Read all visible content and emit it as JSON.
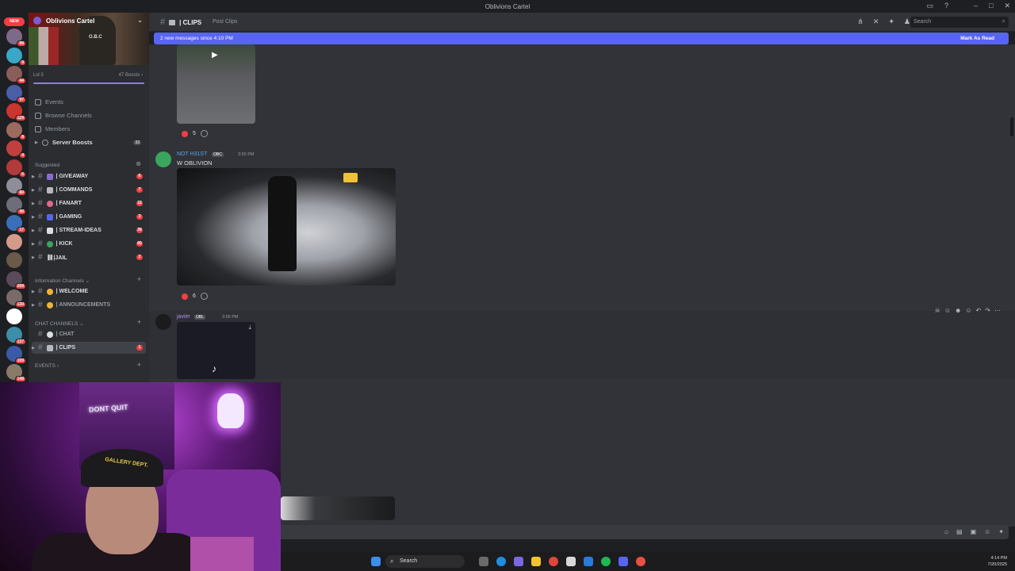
{
  "window": {
    "title": "Oblivions Cartel"
  },
  "rail": {
    "new_badge": "NEW",
    "badges": [
      "99",
      "9",
      "44",
      "97",
      "129",
      "8",
      "4",
      "6",
      "80",
      "40",
      "17",
      "",
      "",
      "209",
      "130",
      "",
      "137",
      "109",
      "148"
    ]
  },
  "server": {
    "name": "Oblivions Cartel",
    "level": "Lvl 3",
    "boosts": "47 Boosts",
    "banner_text": "O.B.C"
  },
  "sidebar": {
    "nav": [
      {
        "label": "Events",
        "icon": "calendar-icon"
      },
      {
        "label": "Browse Channels",
        "icon": "browse-icon"
      },
      {
        "label": "Members",
        "icon": "members-icon"
      }
    ],
    "server_boosts": {
      "label": "Server Boosts",
      "count": "33"
    },
    "suggested_label": "Suggested",
    "suggested": [
      {
        "name": "| GIVEAWAY",
        "count": "6",
        "color": "#8a6ad8"
      },
      {
        "name": "| COMMANDS",
        "count": "7",
        "color": "#b5bac1"
      },
      {
        "name": "| FANART",
        "count": "12",
        "color": "#e06a8a"
      },
      {
        "name": "| GAMING",
        "count": "3",
        "color": "#5865f2"
      },
      {
        "name": "| STREAM-IDEAS",
        "count": "39",
        "color": "#dbdee1"
      },
      {
        "name": "| KICK",
        "count": "60",
        "color": "#3ba55d"
      },
      {
        "name": "⛓|JAIL",
        "count": "2",
        "color": ""
      }
    ],
    "info_label": "Information Channels",
    "info": [
      {
        "name": "| WELCOME",
        "color": "#f0b232"
      },
      {
        "name": "| ANNOUNCEMENTS",
        "color": "#f0b232"
      }
    ],
    "chat_label": "CHAT CHANNELS",
    "chat": [
      {
        "name": "| CHAT",
        "count": ""
      },
      {
        "name": "| CLIPS",
        "count": "1"
      }
    ],
    "events_label": "EVENTS"
  },
  "header": {
    "channel": "| CLIPS",
    "topic": "Post Clips",
    "search_placeholder": "Search"
  },
  "banner": {
    "text": "2 new messages since 4:10 PM",
    "action": "Mark As Read"
  },
  "messages": [
    {
      "reaction_count": "5"
    },
    {
      "author": "NOT H31ST",
      "tag": "OBC",
      "time": "3:55 PM",
      "body": "W OBLIVION",
      "reaction_count": "6"
    },
    {
      "author": "javier",
      "tag": "OBL",
      "time": "3:56 PM"
    }
  ],
  "cam": {
    "sign": "DONT QUIT",
    "cap_text": "GALLERY DEPT."
  },
  "taskbar": {
    "search": "Search",
    "time": "4:14 PM",
    "date": "7/20/2025"
  }
}
